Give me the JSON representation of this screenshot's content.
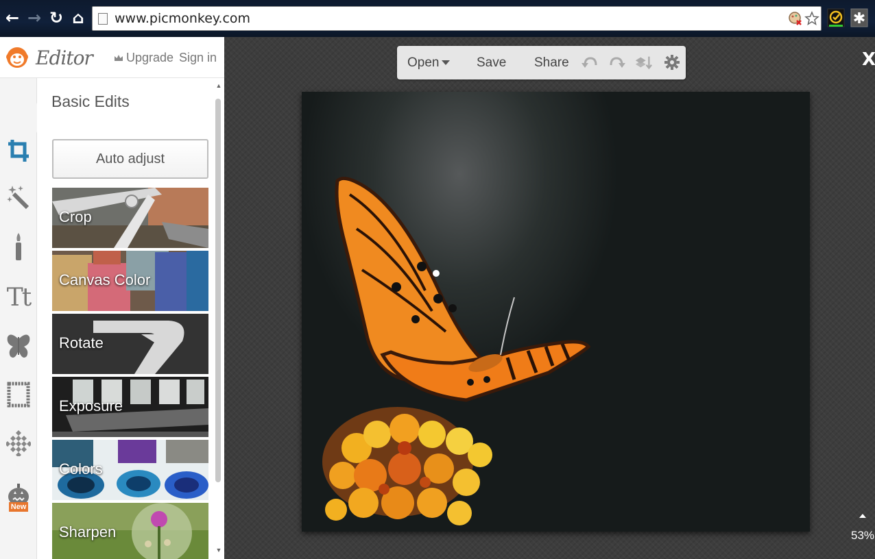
{
  "browser": {
    "url": "www.picmonkey.com"
  },
  "app": {
    "logo_text": "Editor",
    "upgrade_label": "Upgrade",
    "signin_label": "Sign in"
  },
  "rail": {
    "items": [
      "crop-icon",
      "magic-wand-icon",
      "brush-icon",
      "text-icon",
      "butterfly-icon",
      "frame-icon",
      "texture-icon",
      "seasonal-icon"
    ],
    "new_badge": "New",
    "active_color": "#2a7fb0"
  },
  "panel": {
    "section_title": "Basic Edits",
    "auto_adjust_label": "Auto adjust",
    "tiles": [
      {
        "label": "Crop"
      },
      {
        "label": "Canvas Color"
      },
      {
        "label": "Rotate"
      },
      {
        "label": "Exposure"
      },
      {
        "label": "Colors"
      },
      {
        "label": "Sharpen"
      }
    ]
  },
  "toolbar": {
    "open_label": "Open",
    "save_label": "Save",
    "share_label": "Share"
  },
  "canvas": {
    "close_label": "X",
    "zoom_label": "53%"
  }
}
